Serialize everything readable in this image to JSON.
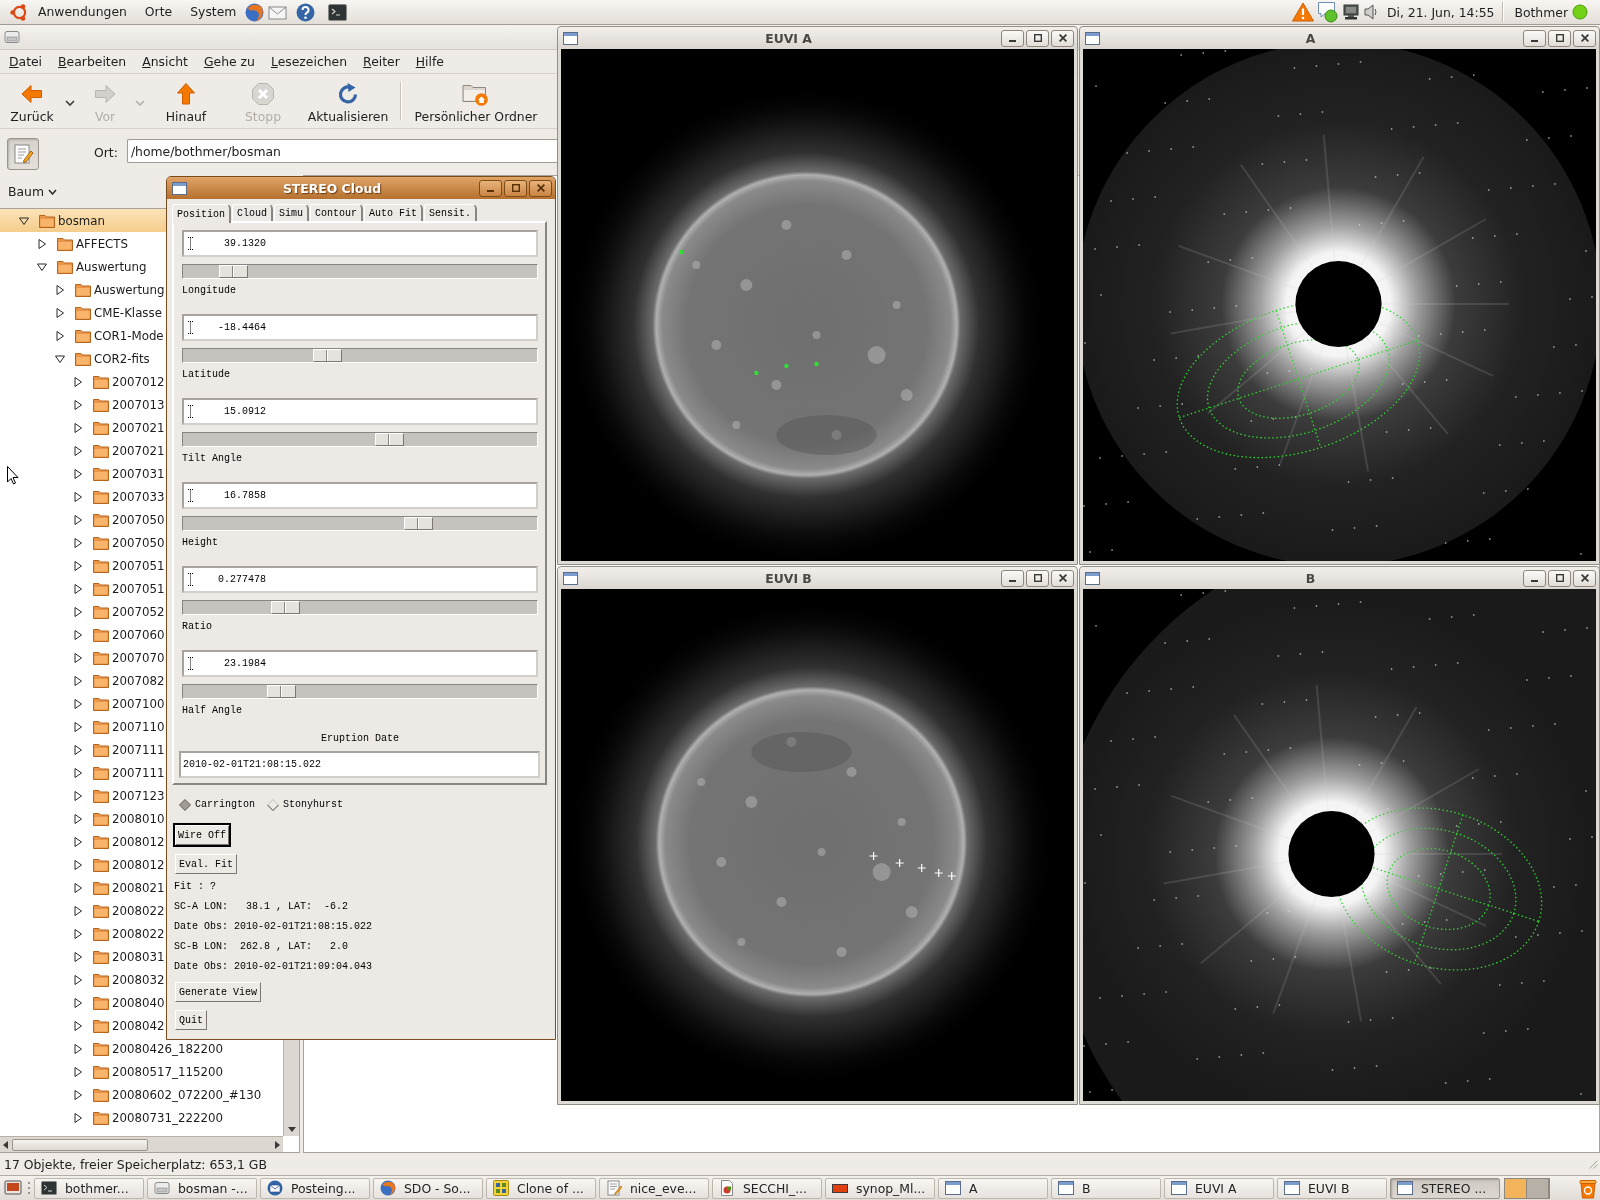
{
  "top_panel": {
    "menus": [
      "Anwendungen",
      "Orte",
      "System"
    ],
    "clock": "Di, 21. Jun, 14:55",
    "user": "Bothmer"
  },
  "file_manager": {
    "menu": [
      "Datei",
      "Bearbeiten",
      "Ansicht",
      "Gehe zu",
      "Lesezeichen",
      "Reiter",
      "Hilfe"
    ],
    "toolbar": [
      {
        "kind": "back",
        "label": "Zurück",
        "disabled": false,
        "dropdown": true
      },
      {
        "kind": "forward",
        "label": "Vor",
        "disabled": true,
        "dropdown": true
      },
      {
        "kind": "up",
        "label": "Hinauf",
        "disabled": false,
        "dropdown": false
      },
      {
        "kind": "stop",
        "label": "Stopp",
        "disabled": true,
        "dropdown": false
      },
      {
        "kind": "reload",
        "label": "Aktualisieren",
        "disabled": false,
        "dropdown": false
      },
      {
        "kind": "home",
        "label": "Persönlicher Ordner",
        "disabled": false,
        "dropdown": false
      }
    ],
    "location": {
      "label": "Ort:",
      "value": "/home/bothmer/bosman"
    },
    "side_pane": {
      "view": "Baum"
    },
    "tree": [
      {
        "label": "bosman",
        "expanded": true,
        "selected": true,
        "children": [
          {
            "label": "AFFECTS",
            "expanded": false,
            "selected": false
          },
          {
            "label": "Auswertung",
            "expanded": true,
            "selected": false,
            "children": [
              {
                "label": "Auswertung",
                "expanded": false,
                "selected": false
              },
              {
                "label": "CME-Klasse",
                "expanded": false,
                "selected": false
              },
              {
                "label": "COR1-Mode",
                "expanded": false,
                "selected": false
              },
              {
                "label": "COR2-fits",
                "expanded": true,
                "selected": false,
                "children": [
                  {
                    "label": "2007012",
                    "expanded": false,
                    "selected": false
                  },
                  {
                    "label": "2007013",
                    "expanded": false,
                    "selected": false
                  },
                  {
                    "label": "2007021",
                    "expanded": false,
                    "selected": false
                  },
                  {
                    "label": "2007021",
                    "expanded": false,
                    "selected": false
                  },
                  {
                    "label": "2007031",
                    "expanded": false,
                    "selected": false
                  },
                  {
                    "label": "2007033",
                    "expanded": false,
                    "selected": false
                  },
                  {
                    "label": "2007050",
                    "expanded": false,
                    "selected": false
                  },
                  {
                    "label": "2007050",
                    "expanded": false,
                    "selected": false
                  },
                  {
                    "label": "2007051",
                    "expanded": false,
                    "selected": false
                  },
                  {
                    "label": "2007051",
                    "expanded": false,
                    "selected": false
                  },
                  {
                    "label": "2007052",
                    "expanded": false,
                    "selected": false
                  },
                  {
                    "label": "2007060",
                    "expanded": false,
                    "selected": false
                  },
                  {
                    "label": "2007070",
                    "expanded": false,
                    "selected": false
                  },
                  {
                    "label": "2007082",
                    "expanded": false,
                    "selected": false
                  },
                  {
                    "label": "2007100",
                    "expanded": false,
                    "selected": false
                  },
                  {
                    "label": "2007110",
                    "expanded": false,
                    "selected": false
                  },
                  {
                    "label": "2007111",
                    "expanded": false,
                    "selected": false
                  },
                  {
                    "label": "2007111",
                    "expanded": false,
                    "selected": false
                  },
                  {
                    "label": "2007123",
                    "expanded": false,
                    "selected": false
                  },
                  {
                    "label": "2008010",
                    "expanded": false,
                    "selected": false
                  },
                  {
                    "label": "2008012",
                    "expanded": false,
                    "selected": false
                  },
                  {
                    "label": "2008012",
                    "expanded": false,
                    "selected": false
                  },
                  {
                    "label": "2008021",
                    "expanded": false,
                    "selected": false
                  },
                  {
                    "label": "2008022",
                    "expanded": false,
                    "selected": false
                  },
                  {
                    "label": "2008022",
                    "expanded": false,
                    "selected": false
                  },
                  {
                    "label": "2008031",
                    "expanded": false,
                    "selected": false
                  },
                  {
                    "label": "2008032",
                    "expanded": false,
                    "selected": false
                  },
                  {
                    "label": "2008040",
                    "expanded": false,
                    "selected": false
                  },
                  {
                    "label": "2008042",
                    "expanded": false,
                    "selected": false
                  },
                  {
                    "label": "20080426_182200",
                    "expanded": false,
                    "selected": false
                  },
                  {
                    "label": "20080517_115200",
                    "expanded": false,
                    "selected": false
                  },
                  {
                    "label": "20080602_072200_#130",
                    "expanded": false,
                    "selected": false
                  },
                  {
                    "label": "20080731_222200",
                    "expanded": false,
                    "selected": false
                  }
                ]
              }
            ]
          }
        ]
      }
    ],
    "status_bar": "17 Objekte, freier Speicherplatz: 653,1 GB"
  },
  "dialog": {
    "title": "STEREO Cloud",
    "active": true,
    "tabs": [
      {
        "label": "Position",
        "selected": true
      },
      {
        "label": "Cloud",
        "selected": false
      },
      {
        "label": "Simu",
        "selected": false
      },
      {
        "label": "Contour",
        "selected": false
      },
      {
        "label": "Auto Fit",
        "selected": false
      },
      {
        "label": "Sensit.",
        "selected": false
      }
    ],
    "sliders": [
      {
        "value": "39.1320",
        "level": 0.11,
        "title": "Longitude"
      },
      {
        "value": "-18.4464",
        "level": 0.4,
        "title": "Latitude"
      },
      {
        "value": "15.0912",
        "level": 0.59,
        "title": "Tilt Angle"
      },
      {
        "value": "16.7858",
        "level": 0.68,
        "title": "Height"
      },
      {
        "value": "0.277478",
        "level": 0.27,
        "title": "Ratio"
      },
      {
        "value": "23.1984",
        "level": 0.26,
        "title": "Half Angle"
      }
    ],
    "date_label": "Eruption Date",
    "date_value": "2010-02-01T21:08:15.022",
    "coordinate_systems": [
      {
        "label": "Carrington",
        "selected": true
      },
      {
        "label": "Stonyhurst",
        "selected": false
      }
    ],
    "upper_buttons": [
      {
        "label": "Wire Off",
        "focused": true
      },
      {
        "label": "Eval. Fit",
        "focused": false
      }
    ],
    "info_lines": [
      "Fit : ?",
      "SC-A LON:   38.1 , LAT:  -6.2",
      "Date Obs: 2010-02-01T21:08:15.022",
      "SC-B LON:  262.8 , LAT:   2.0",
      "Date Obs: 2010-02-01T21:09:04.043"
    ],
    "lower_buttons": [
      {
        "label": "Generate View",
        "focused": false
      },
      {
        "label": "Quit",
        "focused": false
      }
    ]
  },
  "image_windows": [
    {
      "title": "EUVI A",
      "kind": "euvi",
      "active": false
    },
    {
      "title": "A",
      "kind": "coronagraph",
      "active": false
    },
    {
      "title": "EUVI B",
      "kind": "euvi",
      "active": false
    },
    {
      "title": "B",
      "kind": "coronagraph",
      "active": false
    }
  ],
  "taskbar": {
    "tasks": [
      {
        "label": "bothmer...",
        "kind": "terminal",
        "selected": false
      },
      {
        "label": "bosman -...",
        "kind": "files",
        "selected": false
      },
      {
        "label": "Posteing...",
        "kind": "mail",
        "selected": false
      },
      {
        "label": "SDO - So...",
        "kind": "browser",
        "selected": false
      },
      {
        "label": "Clone of ...",
        "kind": "tiles",
        "selected": false
      },
      {
        "label": "nice_eve...",
        "kind": "editor",
        "selected": false
      },
      {
        "label": "SECCHI_...",
        "kind": "document",
        "selected": false
      },
      {
        "label": "synop_Ml...",
        "kind": "image",
        "selected": false
      },
      {
        "label": "A",
        "kind": "window",
        "selected": false
      },
      {
        "label": "B",
        "kind": "window",
        "selected": false
      },
      {
        "label": "EUVI A",
        "kind": "window",
        "selected": false
      },
      {
        "label": "EUVI B",
        "kind": "window",
        "selected": false
      },
      {
        "label": "STEREO ...",
        "kind": "window",
        "selected": true
      }
    ],
    "workspaces": [
      {
        "selected": true
      },
      {
        "selected": false
      }
    ]
  }
}
